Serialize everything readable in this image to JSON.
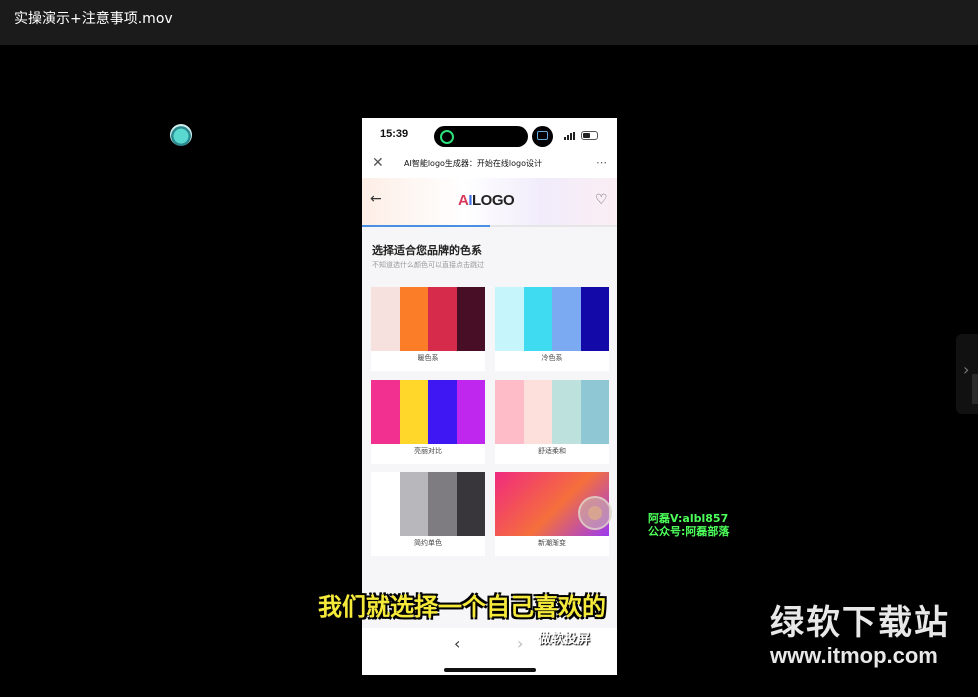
{
  "player": {
    "title": "实操演示+注意事项.mov"
  },
  "phone": {
    "status": {
      "time": "15:39"
    },
    "browser": {
      "close_icon": "close-icon",
      "title": "AI智能logo生成器：开始在线logo设计",
      "more_icon": "more-icon"
    },
    "app": {
      "logo": {
        "a": "A",
        "i": "I",
        "rest": "LOGO"
      },
      "step_progress": 0.5,
      "section_title": "选择适合您品牌的色系",
      "section_subtitle": "不知道选什么颜色可以直接点击跳过",
      "palettes": [
        {
          "label": "暖色系",
          "colors": [
            "#f7e1df",
            "#fb7d27",
            "#d72b4c",
            "#470e26"
          ]
        },
        {
          "label": "冷色系",
          "colors": [
            "#c6f6fb",
            "#3edbf1",
            "#7baaf3",
            "#1309a8"
          ]
        },
        {
          "label": "亮丽对比",
          "colors": [
            "#f1308f",
            "#ffd62a",
            "#3f17f2",
            "#c027ee"
          ]
        },
        {
          "label": "舒适柔和",
          "colors": [
            "#fdbcc7",
            "#fde0db",
            "#bde1dd",
            "#8fc7d5"
          ]
        },
        {
          "label": "简约单色",
          "colors": [
            "#ffffff",
            "#b8b8bc",
            "#7e7c80",
            "#38363a"
          ]
        },
        {
          "label": "新潮渐变",
          "gradient": [
            "#f02a7e",
            "#f56f3c",
            "#9b3bf0"
          ]
        }
      ]
    },
    "dock": {
      "prev_icon": "chevron-left-icon",
      "next_icon": "chevron-right-icon"
    }
  },
  "overlay": {
    "watermark_line1": "阿磊V:albl857",
    "watermark_line2": "公众号:阿磊部落",
    "caption": "我们就选择一个自己喜欢的",
    "caption_sub": "做软投屏",
    "site_name": "绿软下载站",
    "site_url": "www.itmop.com"
  }
}
